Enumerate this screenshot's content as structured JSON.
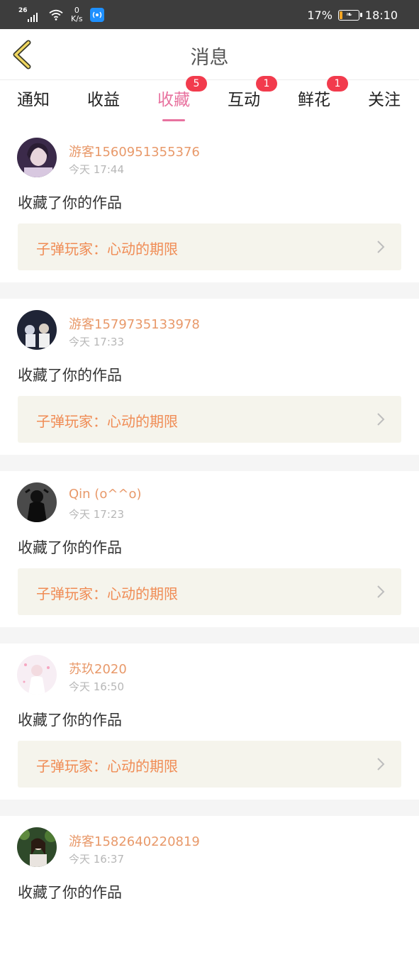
{
  "status_bar": {
    "network": "26",
    "speed_value": "0",
    "speed_unit": "K/s",
    "battery_percent": "17%",
    "battery_level": 0.17,
    "time": "18:10",
    "colors": {
      "bar": "#3d3d3d",
      "battery_fill": "#f5a623",
      "app_icon": "#1e90ff"
    }
  },
  "header": {
    "back_icon": "chevron-left-icon",
    "title": "消息"
  },
  "tabs": [
    {
      "label": "通知",
      "badge": ""
    },
    {
      "label": "收益",
      "badge": ""
    },
    {
      "label": "收藏",
      "badge": "5",
      "active": true
    },
    {
      "label": "互动",
      "badge": "1"
    },
    {
      "label": "鲜花",
      "badge": "1"
    },
    {
      "label": "关注",
      "badge": ""
    }
  ],
  "feed": {
    "items": [
      {
        "user": "游客1560951355376",
        "time": "今天 17:44",
        "action": "收藏了你的作品",
        "work_title": "子弹玩家：心动的期限"
      },
      {
        "user": "游客1579735133978",
        "time": "今天 17:33",
        "action": "收藏了你的作品",
        "work_title": "子弹玩家：心动的期限"
      },
      {
        "user": "Qin (o^^o)",
        "time": "今天 17:23",
        "action": "收藏了你的作品",
        "work_title": "子弹玩家：心动的期限"
      },
      {
        "user": "苏玖2020",
        "time": "今天 16:50",
        "action": "收藏了你的作品",
        "work_title": "子弹玩家：心动的期限"
      },
      {
        "user": "游客1582640220819",
        "time": "今天 16:37",
        "action": "收藏了你的作品",
        "work_title": ""
      }
    ]
  },
  "colors": {
    "accent": "#e8729f",
    "username": "#e8996a",
    "work_title": "#f08c55",
    "badge": "#f23b4d",
    "back_arrow": "#f0d760"
  }
}
